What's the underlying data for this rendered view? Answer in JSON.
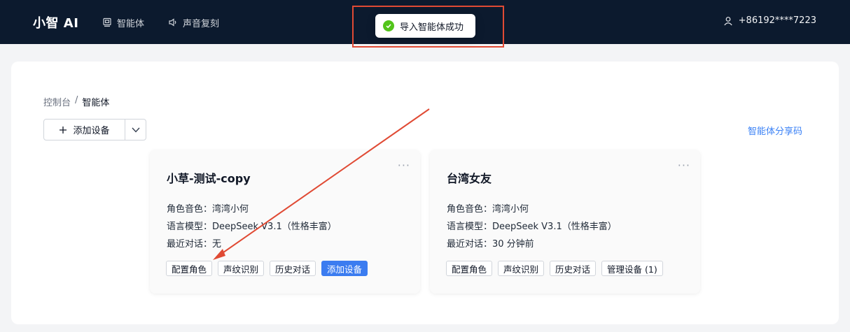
{
  "header": {
    "brand": "小智 AI",
    "nav": [
      {
        "label": "智能体",
        "icon": "agent-icon"
      },
      {
        "label": "声音复刻",
        "icon": "speaker-icon"
      }
    ],
    "user_phone": "+86192****7223"
  },
  "toast": {
    "message": "导入智能体成功",
    "icon": "check-circle-icon",
    "color": "#52c41a"
  },
  "breadcrumb": {
    "root": "控制台",
    "separator": "/",
    "current": "智能体"
  },
  "toolbar": {
    "add_device_label": "添加设备",
    "share_code_label": "智能体分享码"
  },
  "agents": [
    {
      "name": "小草-测试-copy",
      "voice": "角色音色：湾湾小何",
      "model": "语言模型：DeepSeek V3.1（性格丰富）",
      "recent": "最近对话：无",
      "actions": [
        "配置角色",
        "声纹识别",
        "历史对话",
        "添加设备"
      ]
    },
    {
      "name": "台湾女友",
      "voice": "角色音色：湾湾小何",
      "model": "语言模型：DeepSeek V3.1（性格丰富）",
      "recent": "最近对话：30 分钟前",
      "actions": [
        "配置角色",
        "声纹识别",
        "历史对话",
        "管理设备 (1)"
      ]
    }
  ],
  "colors": {
    "accent": "#3b7cf0",
    "annotation": "#e04a34",
    "nav_bg": "#0c1a2e"
  }
}
